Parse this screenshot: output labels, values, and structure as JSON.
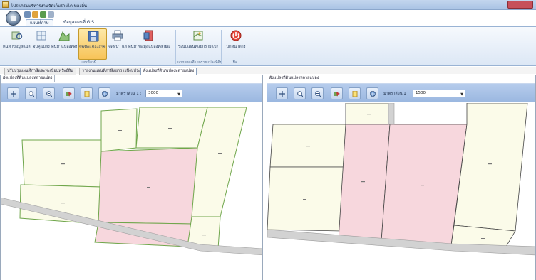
{
  "window": {
    "title": "โปรแกรมบริหารงานจัดเก็บรายได้ ท้องถิ่น",
    "colors": {
      "title_bar": "#b8cde9",
      "close_button": "#c7505a"
    }
  },
  "ribbon": {
    "tabs": [
      {
        "label": "แผนที่ภาษี",
        "active": true
      },
      {
        "label": "ข้อมูลแผนที่ GIS",
        "active": false
      }
    ],
    "buttons": [
      {
        "label": "ค้นหาข้อมูลแปลงที่ดิน",
        "icon": "map-search-icon"
      },
      {
        "label": "จับคู่แปลง",
        "icon": "parcel-link-icon"
      },
      {
        "label": "ค้นหาแปลงที่ดิน",
        "icon": "parcel-icon"
      },
      {
        "label": "บันทึกแปลงสาขา",
        "icon": "save-icon",
        "selected": true
      },
      {
        "label": "จัดหน้า และ",
        "icon": "print-icon"
      },
      {
        "label": "ค้นหาข้อมูลแปลงหลายแปลงที่ดิน",
        "icon": "layer-icon"
      },
      {
        "label": "ระบบแผนที่แยกรายแปลงที่ดิน",
        "icon": "gis-icon"
      },
      {
        "label": "ปิดหน้าต่าง",
        "icon": "close-window-icon"
      }
    ],
    "groups": [
      "แผนที่ภาษี",
      "ระบบแผนที่แยกรายแปลงที่ดิน",
      "ปิด"
    ]
  },
  "document_tabs": [
    {
      "label": "ปรับปรุงแผนที่ภาษีและทะเบียนทรัพย์สิน",
      "active": false
    },
    {
      "label": "รายงานแผนที่ภาษีแยกรายปีงบประมาณ",
      "active": false
    },
    {
      "label": "ผังแปลงที่ดิน/แปลงหลายแปลง",
      "active": true
    }
  ],
  "panels": {
    "left": {
      "title": "ผังแปลงที่ดินแปลงหลายแปลง",
      "scale_label": "มาตราส่วน 1 :",
      "scale_value": "3000",
      "tools": [
        "pan-icon",
        "zoom-in-icon",
        "zoom-out-icon",
        "select-parcel-icon",
        "identify-icon",
        "full-extent-icon"
      ]
    },
    "right": {
      "title": "ผังแปลงที่ดินแปลงหลายแปลง",
      "scale_label": "มาตราส่วน 1 :",
      "scale_value": "1500",
      "tools": [
        "pan-icon",
        "zoom-in-icon",
        "zoom-out-icon",
        "select-parcel-icon",
        "identify-icon",
        "full-extent-icon"
      ]
    }
  },
  "map_colors": {
    "parcel_fill": "#fbfbe9",
    "parcel_line": "#6fa64b",
    "selected_fill": "#f7d7dd",
    "road": "#d2d2d2"
  }
}
